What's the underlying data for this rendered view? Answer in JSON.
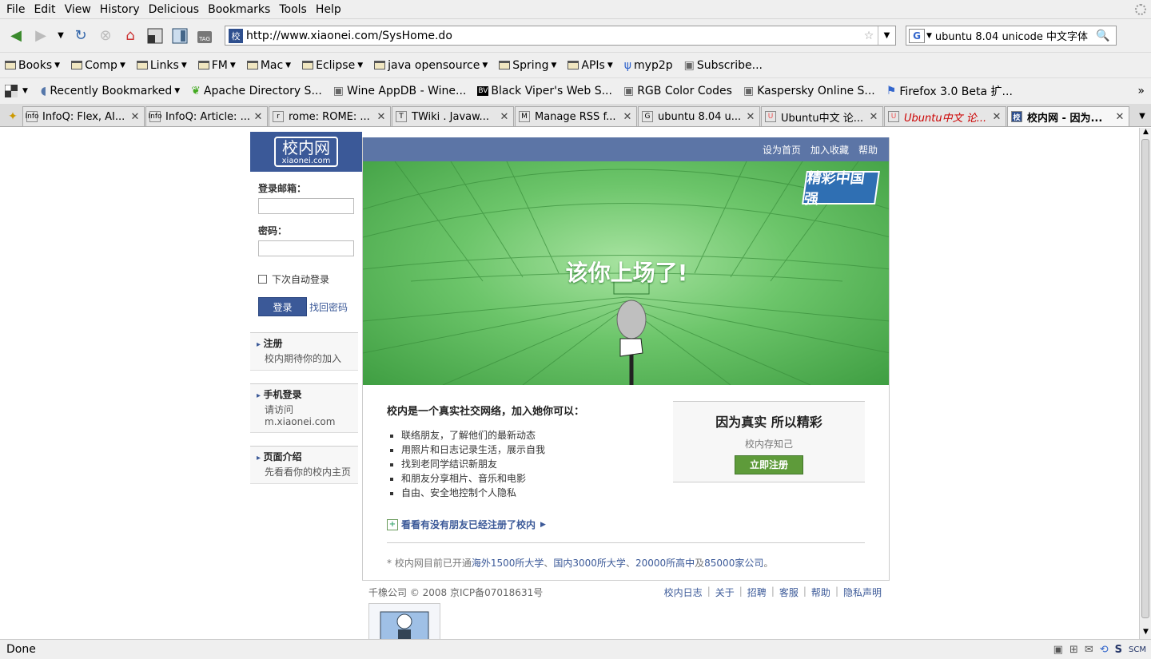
{
  "menu": [
    "File",
    "Edit",
    "View",
    "History",
    "Delicious",
    "Bookmarks",
    "Tools",
    "Help"
  ],
  "url": "http://www.xiaonei.com/SysHome.do",
  "url_favicon": "校",
  "search": {
    "engine": "G",
    "value": "ubuntu 8.04 unicode 中文字体"
  },
  "bookmarks1": [
    "Books",
    "Comp",
    "Links",
    "FM",
    "Mac",
    "Eclipse",
    "java opensource",
    "Spring",
    "APIs",
    "myp2p",
    "Subscribe..."
  ],
  "bookmarks2": [
    "Recently Bookmarked",
    "Apache Directory S...",
    "Wine AppDB - Wine...",
    "Black Viper's Web S...",
    "RGB Color Codes",
    "Kaspersky Online S...",
    "Firefox 3.0 Beta 扩..."
  ],
  "tabs": [
    {
      "label": "InfoQ: Flex, AI...",
      "icon": "Info"
    },
    {
      "label": "InfoQ: Article: ...",
      "icon": "Info"
    },
    {
      "label": "rome: ROME: ...",
      "icon": "r"
    },
    {
      "label": "TWiki . Javaw...",
      "icon": "T"
    },
    {
      "label": "Manage RSS f...",
      "icon": "M"
    },
    {
      "label": "ubuntu 8.04 u...",
      "icon": "G"
    },
    {
      "label": "Ubuntu中文 论...",
      "icon": "U"
    },
    {
      "label": "Ubuntu中文 论...",
      "icon": "U"
    },
    {
      "label": "校内网 - 因为...",
      "icon": "校"
    }
  ],
  "status": "Done",
  "page": {
    "logo": "校内网",
    "logo_sub": "xiaonei.com",
    "login_email_label": "登录邮箱：",
    "login_password_label": "密码：",
    "auto_login": "下次自动登录",
    "login_button": "登录",
    "forgot": "找回密码",
    "side": [
      {
        "title": "注册",
        "desc": "校内期待你的加入"
      },
      {
        "title": "手机登录",
        "desc": "请访问m.xiaonei.com"
      },
      {
        "title": "页面介绍",
        "desc": "先看看你的校内主页"
      }
    ],
    "top_links": [
      "设为首页",
      "加入收藏",
      "帮助"
    ],
    "slogan": "该你上场了!",
    "badge": "精彩中国强",
    "intro_title": "校内是一个真实社交网络，加入她你可以：",
    "features": [
      "联络朋友，了解他们的最新动态",
      "用照片和日志记录生活，展示自我",
      "找到老同学结识新朋友",
      "和朋友分享相片、音乐和电影",
      "自由、安全地控制个人隐私"
    ],
    "reg_title": "因为真实 所以精彩",
    "reg_sub": "校内存知己",
    "reg_button": "立即注册",
    "find_friends": "看看有没有朋友已经注册了校内",
    "stats": {
      "prefix": "* 校内网目前已开通",
      "a": "海外1500所大学",
      "sep1": "、",
      "b": "国内3000所大学",
      "sep2": "、",
      "c": "20000所高中",
      "mid": "及",
      "d": "85000家公司",
      "suffix": "。"
    },
    "copyright": "千橡公司 © 2008 京ICP备07018631号",
    "footer_links": [
      "校内日志",
      "关于",
      "招聘",
      "客服",
      "帮助",
      "隐私声明"
    ]
  },
  "colors": {
    "brand": "#3b5998",
    "hero_green": "#6cc56a",
    "register_green": "#5e9b3a"
  }
}
